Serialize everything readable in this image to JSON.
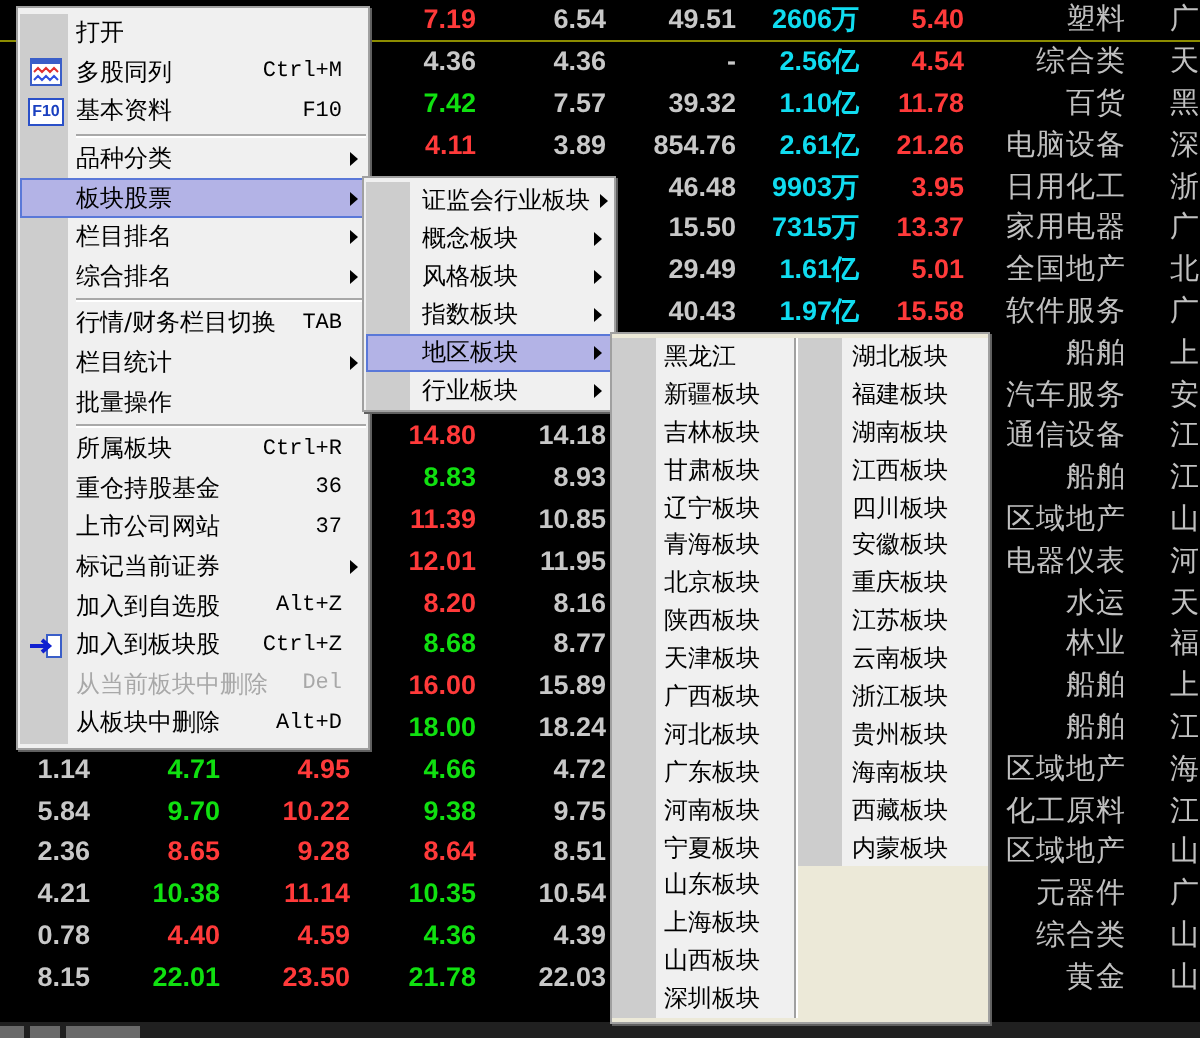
{
  "quote_table": {
    "rows": [
      {
        "cells": [
          null,
          null,
          null,
          {
            "text": "7.19",
            "color": "#ff3a3a"
          },
          {
            "text": "6.54",
            "color": "#c8c8c8"
          },
          {
            "text": "49.51",
            "color": "#c8c8c8"
          },
          {
            "text": "2606万",
            "color": "#10dcf0"
          },
          {
            "text": "5.40",
            "color": "#ff3a3a"
          },
          {
            "text": "塑料",
            "color": "#c0c0c0"
          },
          {
            "text": "广",
            "color": "#c0c0c0"
          }
        ]
      },
      {
        "cells": [
          null,
          null,
          null,
          {
            "text": "4.36",
            "color": "#c8c8c8"
          },
          {
            "text": "4.36",
            "color": "#c8c8c8"
          },
          {
            "text": "-",
            "color": "#c8c8c8"
          },
          {
            "text": "2.56亿",
            "color": "#10dcf0"
          },
          {
            "text": "4.54",
            "color": "#ff3a3a"
          },
          {
            "text": "综合类",
            "color": "#c0c0c0"
          },
          {
            "text": "天",
            "color": "#c0c0c0"
          }
        ]
      },
      {
        "cells": [
          null,
          null,
          null,
          {
            "text": "7.42",
            "color": "#10e010"
          },
          {
            "text": "7.57",
            "color": "#c8c8c8"
          },
          {
            "text": "39.32",
            "color": "#c8c8c8"
          },
          {
            "text": "1.10亿",
            "color": "#10dcf0"
          },
          {
            "text": "11.78",
            "color": "#ff3a3a"
          },
          {
            "text": "百货",
            "color": "#c0c0c0"
          },
          {
            "text": "黑",
            "color": "#c0c0c0"
          }
        ]
      },
      {
        "cells": [
          null,
          null,
          null,
          {
            "text": "4.11",
            "color": "#ff3a3a"
          },
          {
            "text": "3.89",
            "color": "#c8c8c8"
          },
          {
            "text": "854.76",
            "color": "#c8c8c8"
          },
          {
            "text": "2.61亿",
            "color": "#10dcf0"
          },
          {
            "text": "21.26",
            "color": "#ff3a3a"
          },
          {
            "text": "电脑设备",
            "color": "#c0c0c0"
          },
          {
            "text": "深",
            "color": "#c0c0c0"
          }
        ]
      },
      {
        "cells": [
          null,
          null,
          null,
          null,
          null,
          {
            "text": "46.48",
            "color": "#c8c8c8"
          },
          {
            "text": "9903万",
            "color": "#10dcf0"
          },
          {
            "text": "3.95",
            "color": "#ff3a3a"
          },
          {
            "text": "日用化工",
            "color": "#c0c0c0"
          },
          {
            "text": "浙",
            "color": "#c0c0c0"
          }
        ]
      },
      {
        "cells": [
          null,
          null,
          null,
          null,
          null,
          {
            "text": "15.50",
            "color": "#c8c8c8"
          },
          {
            "text": "7315万",
            "color": "#10dcf0"
          },
          {
            "text": "13.37",
            "color": "#ff3a3a"
          },
          {
            "text": "家用电器",
            "color": "#c0c0c0"
          },
          {
            "text": "广",
            "color": "#c0c0c0"
          }
        ]
      },
      {
        "cells": [
          null,
          null,
          null,
          null,
          null,
          {
            "text": "29.49",
            "color": "#c8c8c8"
          },
          {
            "text": "1.61亿",
            "color": "#10dcf0"
          },
          {
            "text": "5.01",
            "color": "#ff3a3a"
          },
          {
            "text": "全国地产",
            "color": "#c0c0c0"
          },
          {
            "text": "北",
            "color": "#c0c0c0"
          }
        ]
      },
      {
        "cells": [
          null,
          null,
          null,
          null,
          null,
          {
            "text": "40.43",
            "color": "#c8c8c8"
          },
          {
            "text": "1.97亿",
            "color": "#10dcf0"
          },
          {
            "text": "15.58",
            "color": "#ff3a3a"
          },
          {
            "text": "软件服务",
            "color": "#c0c0c0"
          },
          {
            "text": "广",
            "color": "#c0c0c0"
          }
        ]
      },
      {
        "cells": [
          null,
          null,
          null,
          null,
          null,
          null,
          null,
          null,
          {
            "text": "船舶",
            "color": "#c0c0c0"
          },
          {
            "text": "上",
            "color": "#c0c0c0"
          }
        ]
      },
      {
        "cells": [
          null,
          null,
          null,
          null,
          null,
          null,
          null,
          null,
          {
            "text": "汽车服务",
            "color": "#c0c0c0"
          },
          {
            "text": "安",
            "color": "#c0c0c0"
          }
        ]
      },
      {
        "cells": [
          null,
          null,
          null,
          {
            "text": "14.80",
            "color": "#ff3a3a"
          },
          {
            "text": "14.18",
            "color": "#c8c8c8"
          },
          null,
          null,
          null,
          {
            "text": "通信设备",
            "color": "#c0c0c0"
          },
          {
            "text": "江",
            "color": "#c0c0c0"
          }
        ]
      },
      {
        "cells": [
          null,
          null,
          null,
          {
            "text": "8.83",
            "color": "#10e010"
          },
          {
            "text": "8.93",
            "color": "#c8c8c8"
          },
          null,
          null,
          null,
          {
            "text": "船舶",
            "color": "#c0c0c0"
          },
          {
            "text": "江",
            "color": "#c0c0c0"
          }
        ]
      },
      {
        "cells": [
          null,
          null,
          null,
          {
            "text": "11.39",
            "color": "#ff3a3a"
          },
          {
            "text": "10.85",
            "color": "#c8c8c8"
          },
          null,
          null,
          null,
          {
            "text": "区域地产",
            "color": "#c0c0c0"
          },
          {
            "text": "山",
            "color": "#c0c0c0"
          }
        ]
      },
      {
        "cells": [
          null,
          null,
          null,
          {
            "text": "12.01",
            "color": "#ff3a3a"
          },
          {
            "text": "11.95",
            "color": "#c8c8c8"
          },
          null,
          null,
          null,
          {
            "text": "电器仪表",
            "color": "#c0c0c0"
          },
          {
            "text": "河",
            "color": "#c0c0c0"
          }
        ]
      },
      {
        "cells": [
          null,
          null,
          null,
          {
            "text": "8.20",
            "color": "#ff3a3a"
          },
          {
            "text": "8.16",
            "color": "#c8c8c8"
          },
          null,
          null,
          null,
          {
            "text": "水运",
            "color": "#c0c0c0"
          },
          {
            "text": "天",
            "color": "#c0c0c0"
          }
        ]
      },
      {
        "cells": [
          null,
          null,
          null,
          {
            "text": "8.68",
            "color": "#10e010"
          },
          {
            "text": "8.77",
            "color": "#c8c8c8"
          },
          null,
          null,
          null,
          {
            "text": "林业",
            "color": "#c0c0c0"
          },
          {
            "text": "福",
            "color": "#c0c0c0"
          }
        ]
      },
      {
        "cells": [
          null,
          null,
          null,
          {
            "text": "16.00",
            "color": "#ff3a3a"
          },
          {
            "text": "15.89",
            "color": "#c8c8c8"
          },
          null,
          null,
          null,
          {
            "text": "船舶",
            "color": "#c0c0c0"
          },
          {
            "text": "上",
            "color": "#c0c0c0"
          }
        ]
      },
      {
        "cells": [
          null,
          null,
          null,
          {
            "text": "18.00",
            "color": "#10e010"
          },
          {
            "text": "18.24",
            "color": "#c8c8c8"
          },
          null,
          null,
          null,
          {
            "text": "船舶",
            "color": "#c0c0c0"
          },
          {
            "text": "江",
            "color": "#c0c0c0"
          }
        ]
      },
      {
        "cells": [
          {
            "text": "1.14",
            "color": "#c8c8c8"
          },
          {
            "text": "4.71",
            "color": "#10e010"
          },
          {
            "text": "4.95",
            "color": "#ff3a3a"
          },
          {
            "text": "4.66",
            "color": "#10e010"
          },
          {
            "text": "4.72",
            "color": "#c8c8c8"
          },
          null,
          null,
          null,
          {
            "text": "区域地产",
            "color": "#c0c0c0"
          },
          {
            "text": "海",
            "color": "#c0c0c0"
          }
        ]
      },
      {
        "cells": [
          {
            "text": "5.84",
            "color": "#c8c8c8"
          },
          {
            "text": "9.70",
            "color": "#10e010"
          },
          {
            "text": "10.22",
            "color": "#ff3a3a"
          },
          {
            "text": "9.38",
            "color": "#10e010"
          },
          {
            "text": "9.75",
            "color": "#c8c8c8"
          },
          null,
          null,
          null,
          {
            "text": "化工原料",
            "color": "#c0c0c0"
          },
          {
            "text": "江",
            "color": "#c0c0c0"
          }
        ]
      },
      {
        "cells": [
          {
            "text": "2.36",
            "color": "#c8c8c8"
          },
          {
            "text": "8.65",
            "color": "#ff3a3a"
          },
          {
            "text": "9.28",
            "color": "#ff3a3a"
          },
          {
            "text": "8.64",
            "color": "#ff3a3a"
          },
          {
            "text": "8.51",
            "color": "#c8c8c8"
          },
          null,
          null,
          null,
          {
            "text": "区域地产",
            "color": "#c0c0c0"
          },
          {
            "text": "山",
            "color": "#c0c0c0"
          }
        ]
      },
      {
        "cells": [
          {
            "text": "4.21",
            "color": "#c8c8c8"
          },
          {
            "text": "10.38",
            "color": "#10e010"
          },
          {
            "text": "11.14",
            "color": "#ff3a3a"
          },
          {
            "text": "10.35",
            "color": "#10e010"
          },
          {
            "text": "10.54",
            "color": "#c8c8c8"
          },
          null,
          null,
          null,
          {
            "text": "元器件",
            "color": "#c0c0c0"
          },
          {
            "text": "广",
            "color": "#c0c0c0"
          }
        ]
      },
      {
        "cells": [
          {
            "text": "0.78",
            "color": "#c8c8c8"
          },
          {
            "text": "4.40",
            "color": "#ff3a3a"
          },
          {
            "text": "4.59",
            "color": "#ff3a3a"
          },
          {
            "text": "4.36",
            "color": "#10e010"
          },
          {
            "text": "4.39",
            "color": "#c8c8c8"
          },
          null,
          null,
          null,
          {
            "text": "综合类",
            "color": "#c0c0c0"
          },
          {
            "text": "山",
            "color": "#c0c0c0"
          }
        ]
      },
      {
        "cells": [
          {
            "text": "8.15",
            "color": "#c8c8c8"
          },
          {
            "text": "22.01",
            "color": "#10e010"
          },
          {
            "text": "23.50",
            "color": "#ff3a3a"
          },
          {
            "text": "21.78",
            "color": "#10e010"
          },
          {
            "text": "22.03",
            "color": "#c8c8c8"
          },
          null,
          null,
          null,
          {
            "text": "黄金",
            "color": "#c0c0c0"
          },
          {
            "text": "山",
            "color": "#c0c0c0"
          }
        ]
      }
    ]
  },
  "context_menu": {
    "items": [
      {
        "kind": "item",
        "label": "打开",
        "has_submenu": false,
        "selected": false,
        "disabled": false
      },
      {
        "kind": "chart",
        "label": "多股同列",
        "shortcut": "Ctrl+M",
        "has_submenu": false,
        "selected": false,
        "disabled": false
      },
      {
        "kind": "badge",
        "label": "基本资料",
        "shortcut": "F10",
        "icon_text": "F10",
        "has_submenu": false,
        "selected": false,
        "disabled": false
      },
      {
        "kind": "separator"
      },
      {
        "kind": "item",
        "label": "品种分类",
        "has_submenu": true,
        "selected": false,
        "disabled": false
      },
      {
        "kind": "item",
        "label": "板块股票",
        "has_submenu": true,
        "selected": true,
        "disabled": false
      },
      {
        "kind": "item",
        "label": "栏目排名",
        "has_submenu": true,
        "selected": false,
        "disabled": false
      },
      {
        "kind": "item",
        "label": "综合排名",
        "has_submenu": true,
        "selected": false,
        "disabled": false
      },
      {
        "kind": "separator"
      },
      {
        "kind": "item",
        "label": "行情/财务栏目切换",
        "shortcut": "TAB",
        "has_submenu": false,
        "selected": false,
        "disabled": false
      },
      {
        "kind": "item",
        "label": "栏目统计",
        "has_submenu": true,
        "selected": false,
        "disabled": false
      },
      {
        "kind": "item",
        "label": "批量操作",
        "has_submenu": false,
        "selected": false,
        "disabled": false
      },
      {
        "kind": "separator"
      },
      {
        "kind": "item",
        "label": "所属板块",
        "shortcut": "Ctrl+R",
        "has_submenu": false,
        "selected": false,
        "disabled": false
      },
      {
        "kind": "item",
        "label": "重仓持股基金",
        "shortcut": "36",
        "has_submenu": false,
        "selected": false,
        "disabled": false
      },
      {
        "kind": "item",
        "label": "上市公司网站",
        "shortcut": "37",
        "has_submenu": false,
        "selected": false,
        "disabled": false
      },
      {
        "kind": "item",
        "label": "标记当前证券",
        "has_submenu": true,
        "selected": false,
        "disabled": false
      },
      {
        "kind": "item",
        "label": "加入到自选股",
        "shortcut": "Alt+Z",
        "has_submenu": false,
        "selected": false,
        "disabled": false
      },
      {
        "kind": "link",
        "label": "加入到板块股",
        "shortcut": "Ctrl+Z",
        "has_submenu": false,
        "selected": false,
        "disabled": false
      },
      {
        "kind": "item",
        "label": "从当前板块中删除",
        "shortcut": "Del",
        "has_submenu": false,
        "selected": false,
        "disabled": true
      },
      {
        "kind": "item",
        "label": "从板块中删除",
        "shortcut": "Alt+D",
        "has_submenu": false,
        "selected": false,
        "disabled": false
      }
    ]
  },
  "sector_submenu": {
    "items": [
      {
        "label": "证监会行业板块",
        "has_submenu": true,
        "selected": false
      },
      {
        "label": "概念板块",
        "has_submenu": true,
        "selected": false
      },
      {
        "label": "风格板块",
        "has_submenu": true,
        "selected": false
      },
      {
        "label": "指数板块",
        "has_submenu": true,
        "selected": false
      },
      {
        "label": "地区板块",
        "has_submenu": true,
        "selected": true
      },
      {
        "label": "行业板块",
        "has_submenu": true,
        "selected": false
      }
    ]
  },
  "region_submenu": {
    "columns": [
      {
        "items": [
          {
            "label": "黑龙江",
            "selected": false
          },
          {
            "label": "新疆板块",
            "selected": false
          },
          {
            "label": "吉林板块",
            "selected": false
          },
          {
            "label": "甘肃板块",
            "selected": false
          },
          {
            "label": "辽宁板块",
            "selected": false
          },
          {
            "label": "青海板块",
            "selected": false
          },
          {
            "label": "北京板块",
            "selected": false
          },
          {
            "label": "陕西板块",
            "selected": false
          },
          {
            "label": "天津板块",
            "selected": false
          },
          {
            "label": "广西板块",
            "selected": false
          },
          {
            "label": "河北板块",
            "selected": false
          },
          {
            "label": "广东板块",
            "selected": false
          },
          {
            "label": "河南板块",
            "selected": false
          },
          {
            "label": "宁夏板块",
            "selected": false
          },
          {
            "label": "山东板块",
            "selected": false
          },
          {
            "label": "上海板块",
            "selected": false
          },
          {
            "label": "山西板块",
            "selected": false
          },
          {
            "label": "深圳板块",
            "selected": false
          }
        ]
      },
      {
        "items": [
          {
            "label": "湖北板块",
            "selected": false
          },
          {
            "label": "福建板块",
            "selected": false
          },
          {
            "label": "湖南板块",
            "selected": false
          },
          {
            "label": "江西板块",
            "selected": false
          },
          {
            "label": "四川板块",
            "selected": false
          },
          {
            "label": "安徽板块",
            "selected": false
          },
          {
            "label": "重庆板块",
            "selected": false
          },
          {
            "label": "江苏板块",
            "selected": false
          },
          {
            "label": "云南板块",
            "selected": false
          },
          {
            "label": "浙江板块",
            "selected": false
          },
          {
            "label": "贵州板块",
            "selected": false
          },
          {
            "label": "海南板块",
            "selected": false
          },
          {
            "label": "西藏板块",
            "selected": false
          },
          {
            "label": "内蒙板块",
            "selected": false
          }
        ]
      }
    ]
  }
}
